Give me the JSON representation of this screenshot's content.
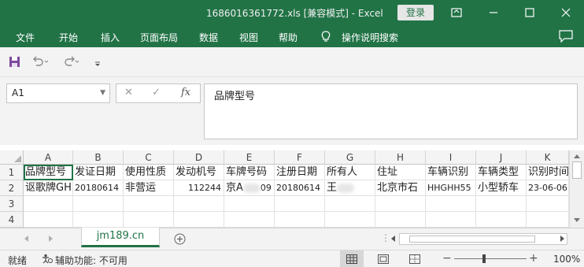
{
  "window": {
    "title": "1686016361772.xls  [兼容模式]  -  Excel",
    "login_label": "登录"
  },
  "ribbon": {
    "tabs": [
      "文件",
      "开始",
      "插入",
      "页面布局",
      "数据",
      "视图",
      "帮助"
    ],
    "tell_me": "操作说明搜索"
  },
  "formula": {
    "name_box": "A1",
    "content": "品牌型号"
  },
  "grid": {
    "columns": [
      "A",
      "B",
      "C",
      "D",
      "E",
      "F",
      "G",
      "H",
      "I",
      "J",
      "K"
    ],
    "rows": [
      "1",
      "2",
      "3",
      "4"
    ],
    "header_row": [
      "品牌型号",
      "发证日期",
      "使用性质",
      "发动机号",
      "车牌号码",
      "注册日期",
      "所有人",
      "住址",
      "车辆识别",
      "车辆类型",
      "识别时间"
    ],
    "data_row": [
      "讴歌牌GH",
      "20180614",
      "非营运",
      "112244",
      "京A",
      "09",
      "20180614",
      "王",
      "北京市石",
      "HHGHH55",
      "小型轿车",
      "23-06-06"
    ]
  },
  "sheets": {
    "active": "jm189.cn"
  },
  "status": {
    "ready": "就绪",
    "accessibility": "辅助功能: 不可用",
    "zoom": "100%"
  },
  "colors": {
    "brand": "#217346",
    "chrome": "#f3f3f3"
  },
  "icons": [
    "save-icon",
    "undo-icon",
    "redo-icon",
    "customize-icon",
    "lightbulb-icon",
    "share-icon",
    "ribbon-display-icon",
    "minimize-icon",
    "maximize-icon",
    "close-icon",
    "cancel-icon",
    "enter-icon",
    "fx-icon",
    "add-sheet-icon",
    "normal-view-icon",
    "page-layout-view-icon",
    "page-break-view-icon"
  ]
}
